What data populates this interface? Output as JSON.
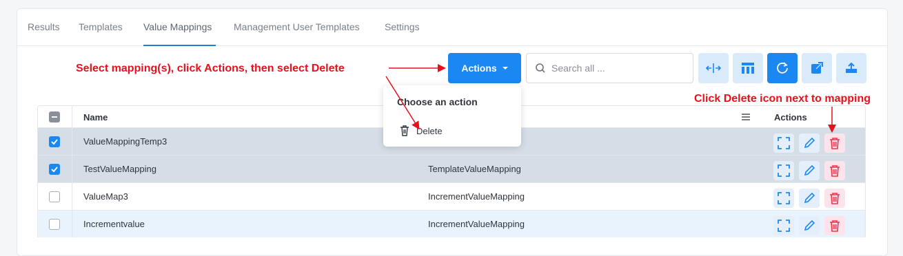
{
  "tabs": [
    "Results",
    "Templates",
    "Value Mappings",
    "Management User Templates",
    "Settings"
  ],
  "actions_label": "Actions",
  "search": {
    "placeholder": "Search all ..."
  },
  "table": {
    "headers": {
      "name": "Name",
      "actions": "Actions"
    },
    "rows": [
      {
        "name": "ValueMappingTemp3",
        "type": "IncrementValueMapping",
        "type_visible": "ng",
        "checked": true
      },
      {
        "name": "TestValueMapping",
        "type": "TemplateValueMapping",
        "checked": true
      },
      {
        "name": "ValueMap3",
        "type": "IncrementValueMapping",
        "checked": false
      },
      {
        "name": "Incrementvalue",
        "type": "IncrementValueMapping",
        "checked": false
      }
    ]
  },
  "dropdown": {
    "title": "Choose an action",
    "item": "Delete"
  },
  "annotations": {
    "left": "Select mapping(s), click Actions, then select Delete",
    "right": "Click Delete icon next to mapping"
  },
  "colors": {
    "accent": "#1b87f2",
    "annotation": "#e8101c",
    "delete": "#e8344f"
  },
  "icons": [
    "search-icon",
    "split-columns-icon",
    "table-layout-icon",
    "refresh-icon",
    "external-link-icon",
    "upload-icon",
    "expand-icon",
    "edit-icon",
    "trash-icon",
    "menu-icon"
  ]
}
